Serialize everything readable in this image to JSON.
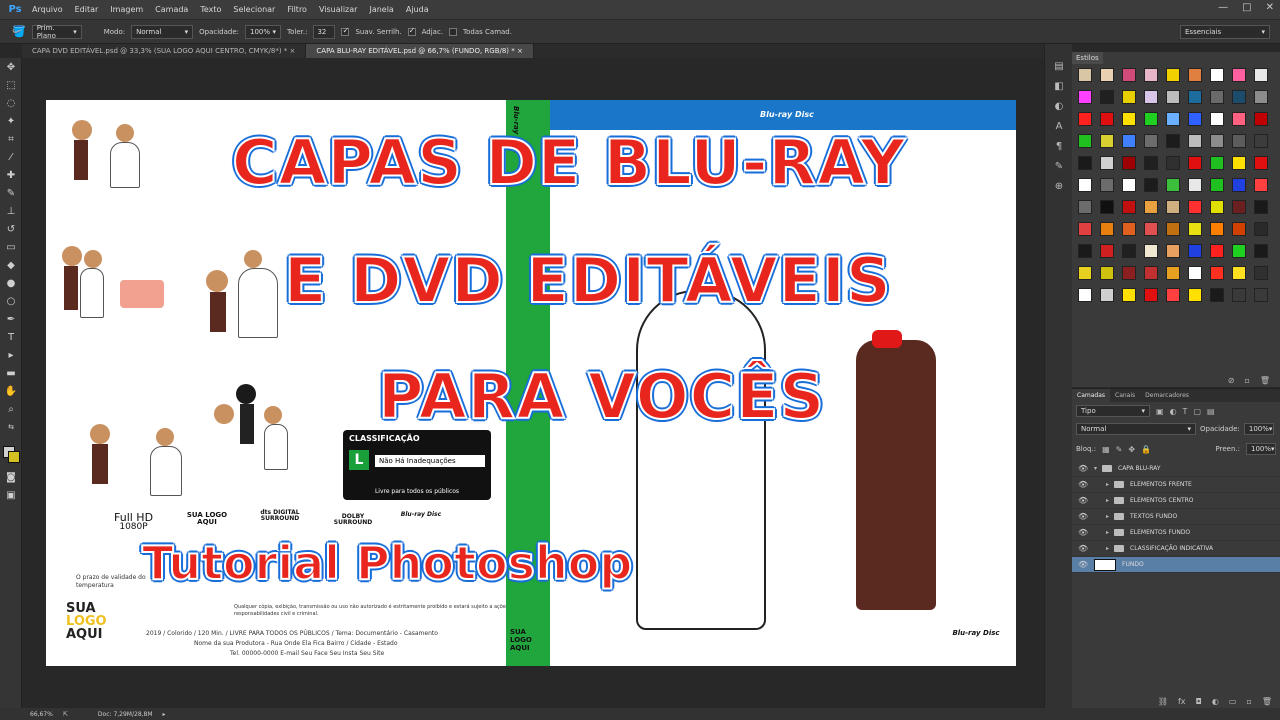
{
  "app": {
    "logo": "Ps"
  },
  "menu": [
    "Arquivo",
    "Editar",
    "Imagem",
    "Camada",
    "Texto",
    "Selecionar",
    "Filtro",
    "Visualizar",
    "Janela",
    "Ajuda"
  ],
  "window_controls": {
    "minimize": "—",
    "maximize": "□",
    "close": "✕"
  },
  "options": {
    "sample_label": "Prim. Plano",
    "mode_label": "Modo:",
    "mode_value": "Normal",
    "opacity_label": "Opacidade:",
    "opacity_value": "100%",
    "tolerance_label": "Toler.:",
    "tolerance_value": "32",
    "antialias_label": "Suav. Serrilh.",
    "contiguous_label": "Adjac.",
    "all_layers_label": "Todas Camad.",
    "workspace": "Essenciais"
  },
  "tabs": [
    {
      "label": "CAPA DVD EDITÁVEL.psd @ 33,3% (SUA LOGO AQUI CENTRO, CMYK/8*) *"
    },
    {
      "label": "CAPA BLU-RAY EDITÁVEL.psd @ 66,7% (FUNDO, RGB/8) *"
    }
  ],
  "document": {
    "spine_text": "Blu-ray Disc",
    "front_header_logo": "Blu-ray Disc",
    "rating_title": "CLASSIFICAÇÃO",
    "rating_letter": "L",
    "rating_desc": "Não Há Inadequações",
    "rating_footer": "Livre para todos os públicos",
    "format_fullhd": "Full HD",
    "format_1080p": "1080P",
    "format_sualogo": "SUA LOGO AQUI",
    "format_dts": "dts DIGITAL SURROUND",
    "format_dolby": "DOLBY SURROUND",
    "format_bluray": "Blu-ray Disc",
    "warning_line1": "Qualquer cópia, exibição, transmissão ou uso não autorizado é estritamente proibido e estará sujeito a ações de",
    "warning_line2": "responsabilidades civil e criminal.",
    "validity_text": "O prazo de validade do",
    "temperature_text": "temperatura",
    "info_line1": "2019 / Colorido / 120 Min. / LIVRE PARA TODOS OS PÚBLICOS / Tema: Documentário - Casamento",
    "info_line2": "Nome da sua Produtora - Rua Onde Ela Fica Bairro / Cidade - Estado",
    "info_line3": "Tel. 00000-0000 E-mail Seu Face Seu Insta Seu Site",
    "logo_sua": "SUA",
    "logo_logo": "LOGO",
    "logo_aqui": "AQUI",
    "back_bluray_logo": "Blu-ray Disc",
    "spine_logo_sua": "SUA",
    "spine_logo_logo": "LOGO",
    "spine_logo_aqui": "AQUI"
  },
  "overlay": {
    "line1": "CAPAS DE BLU-RAY",
    "line2": "E DVD EDITÁVEIS",
    "line3": "PARA VOCÊS",
    "line4": "Tutorial Photoshop"
  },
  "styles_panel": {
    "tab": "Estilos",
    "swatches": [
      "#d9c6a5",
      "#e8d0b0",
      "#d04a7a",
      "#e8b4c8",
      "#f0d000",
      "#e08040",
      "#ffffff",
      "#ff60a0",
      "#e8e8e8",
      "#ff40ff",
      "#202020",
      "#e8d000",
      "#d8c4e8",
      "#bcbcbc",
      "#1c6c9c",
      "#6a6a6a",
      "#1c4c6c",
      "#8c8c8c",
      "#ff2020",
      "#e01010",
      "#ffe000",
      "#20d020",
      "#6ab0ff",
      "#3060ff",
      "#ffffff",
      "#ff6080",
      "#c00000",
      "#20c020",
      "#d8d030",
      "#4080ff",
      "#6c6c6c",
      "#1c1c1c",
      "#bcbcbc",
      "#8c8c8c",
      "#5c5c5c",
      "#3c3c3c",
      "#1a1a1a",
      "#d0d0d0",
      "#9c0000",
      "#202020",
      "#303030",
      "#e01010",
      "#20c020",
      "#ffe000",
      "#e01010",
      "#ffffff",
      "#6c6c6c",
      "#ffffff",
      "#1c1c1c",
      "#3cc03c",
      "#e8e8e8",
      "#20c020",
      "#2040e0",
      "#ff4040",
      "#6c6c6c",
      "#101010",
      "#c01010",
      "#e8a040",
      "#d0b080",
      "#ff3030",
      "#e0e000",
      "#6a2020",
      "#1a1a1a",
      "#e04040",
      "#e88010",
      "#e06020",
      "#e05050",
      "#c07010",
      "#e8e010",
      "#ff8000",
      "#d04000",
      "#2a2a2a",
      "#1a1a1a",
      "#d02020",
      "#202020",
      "#f0e8d0",
      "#e8a060",
      "#2040e0",
      "#ff2020",
      "#20d020",
      "#1a1a1a",
      "#e8d020",
      "#d0c010",
      "#8c2020",
      "#c03030",
      "#e8a020",
      "#ffffff",
      "#ff3020",
      "#ffe020",
      "#303030",
      "#ffffff",
      "#cfcfcf",
      "#ffe000",
      "#e01010",
      "#ff4040",
      "#ffe000",
      "#1a1a1a",
      "#3a3a3a",
      "#3a3a3a"
    ],
    "footer_icons": [
      "delete-icon",
      "new-style-icon",
      "trash-icon"
    ]
  },
  "layers_panel": {
    "tabs": [
      "Camadas",
      "Canais",
      "Demarcadores"
    ],
    "filter_label": "Tipo",
    "blend_mode": "Normal",
    "opacity_label": "Opacidade:",
    "opacity_value": "100%",
    "lock_label": "Bloq.:",
    "fill_label": "Preen.:",
    "fill_value": "100%",
    "layers": [
      {
        "name": "CAPA BLU-RAY",
        "indent": 0,
        "selected": false
      },
      {
        "name": "ELEMENTOS FRENTE",
        "indent": 1,
        "selected": false
      },
      {
        "name": "ELEMENTOS CENTRO",
        "indent": 1,
        "selected": false
      },
      {
        "name": "TEXTOS FUNDO",
        "indent": 1,
        "selected": false
      },
      {
        "name": "ELEMENTOS FUNDO",
        "indent": 1,
        "selected": false
      },
      {
        "name": "CLASSIFICAÇÃO INDICATIVA",
        "indent": 1,
        "selected": false
      },
      {
        "name": "FUNDO",
        "indent": 0,
        "selected": true
      }
    ]
  },
  "status": {
    "zoom": "66,67%",
    "doc": "Doc: 7,29M/28,8M"
  }
}
